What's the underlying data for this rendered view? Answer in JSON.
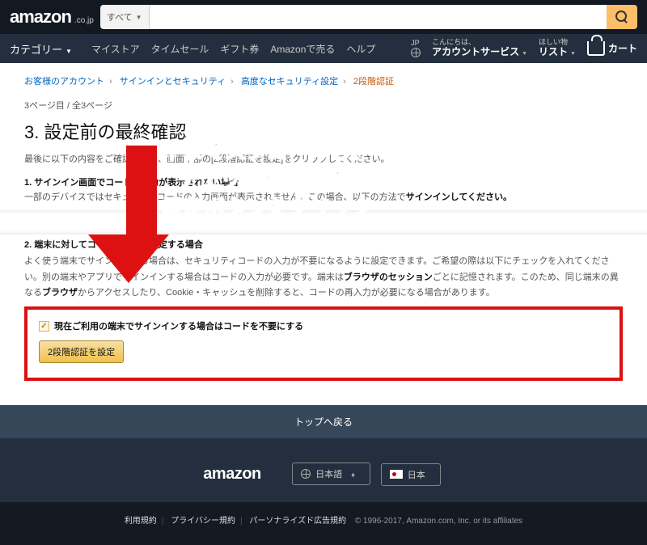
{
  "header": {
    "logo_suffix": ".co.jp",
    "search_category": "すべて",
    "category_label": "カテゴリー",
    "links": [
      "マイストア",
      "タイムセール",
      "ギフト券",
      "Amazonで売る",
      "ヘルプ"
    ],
    "jp_label": "JP",
    "greeting_small": "こんにちは、",
    "account_label": "アカウントサービス",
    "wishlist_small": "ほしい物",
    "wishlist_label": "リスト",
    "cart_label": "カート"
  },
  "breadcrumb": {
    "items": [
      "お客様のアカウント",
      "サインインとセキュリティ",
      "高度なセキュリティ設定"
    ],
    "current": "2段階認証"
  },
  "page": {
    "pager": "3ページ目 / 全3ページ",
    "title": "3. 設定前の最終確認",
    "intro": "最後に以下の内容をご確認のうえ、画面下部の[2段階認証を設定]をクリックしてください。",
    "sub1_num": "1.",
    "sub1_title": "サインイン画面でコードの入力が表示されない場合",
    "sub1_body_a": "一部のデバイスではセキュリティコードの入力画面が表示されません。この場合、以下の方法で",
    "sub1_bold": "サインインしてください。",
    "sub2_title": "2. 端末に対してコードを不要に設定する場合",
    "sub2_body": "よく使う端末でサインインする場合は、セキュリティコードの入力が不要になるように設定できます。ご希望の際は以下にチェックを入れてください。別の端末やアプリでサインインする場合はコードの入力が必要です。端末は",
    "sub2_bold1": "ブラウザのセッション",
    "sub2_mid": "ごとに記憶されます。このため、同じ端末の異なる",
    "sub2_bold2": "ブラウザ",
    "sub2_tail": "からアクセスしたり、Cookie・キャッシュを削除すると、コードの再入力が必要になる場合があります。",
    "checkbox_label": "現在ご利用の端末でサインインする場合はコードを不要にする",
    "button_label": "2段階認証を設定"
  },
  "annotation": {
    "line1": "下までスクロールし、",
    "line2": "チェックを付けて",
    "line3": "設定ボタンをクリック"
  },
  "footer": {
    "back_to_top": "トップへ戻る",
    "logo": "amazon",
    "language": "日本語",
    "country": "日本",
    "terms": "利用規約",
    "privacy": "プライバシー規約",
    "ads": "パーソナライズド広告規約",
    "copyright": "© 1996-2017, Amazon.com, Inc. or its affiliates"
  }
}
